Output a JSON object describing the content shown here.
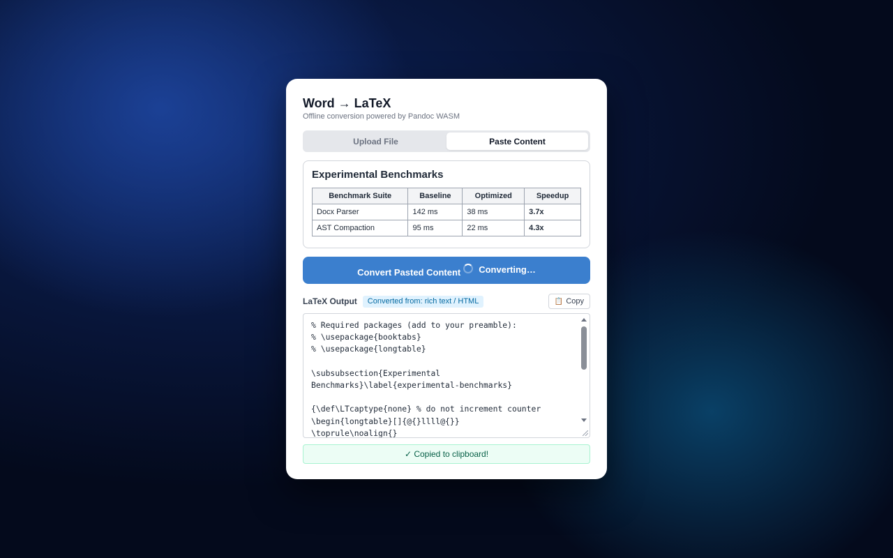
{
  "app": {
    "title": "Word → LaTeX",
    "subtitle": "Offline conversion powered by Pandoc WASM"
  },
  "tabs": [
    {
      "label": "Upload File",
      "active": false
    },
    {
      "label": "Paste Content",
      "active": true
    }
  ],
  "preview": {
    "heading": "Experimental Benchmarks",
    "columns": [
      "Benchmark Suite",
      "Baseline",
      "Optimized",
      "Speedup"
    ],
    "rows": [
      [
        "Docx Parser",
        "142 ms",
        "38 ms",
        "3.7x"
      ],
      [
        "AST Compaction",
        "95 ms",
        "22 ms",
        "4.3x"
      ]
    ]
  },
  "convert_button": {
    "label": "Convert Pasted Content",
    "status": "Converting…"
  },
  "output": {
    "label": "LaTeX Output",
    "badge": "Converted from: rich text / HTML",
    "copy_label": "Copy",
    "copy_icon": "clipboard-icon",
    "latex": "% Required packages (add to your preamble):\n% \\usepackage{booktabs}\n% \\usepackage{longtable}\n\n\\subsubsection{Experimental\nBenchmarks}\\label{experimental-benchmarks}\n\n{\\def\\LTcaptype{none} % do not increment counter\n\\begin{longtable}[]{@{}llll@{}}\n\\toprule\\noalign{}"
  },
  "toast": {
    "message": "✓ Copied to clipboard!"
  },
  "colors": {
    "accent": "#3b7fce",
    "success_bg": "#ecfdf5",
    "success_text": "#065f46",
    "badge_bg": "#e0f2fe",
    "badge_text": "#0369a1"
  }
}
